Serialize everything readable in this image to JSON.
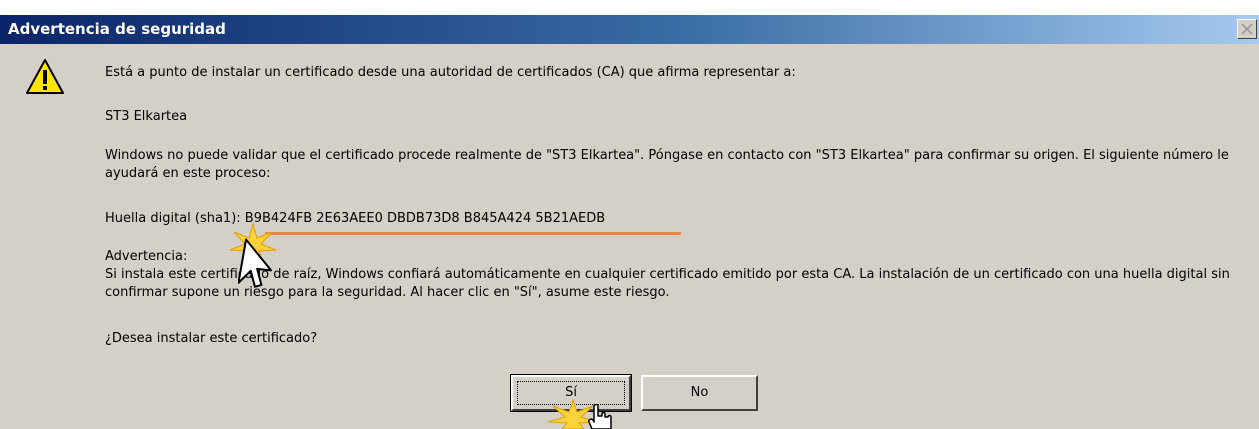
{
  "dialog": {
    "title": "Advertencia de seguridad",
    "intro": "Está a punto de instalar un certificado desde una autoridad de certificados (CA) que afirma representar a:",
    "ca_name": "ST3 Elkartea",
    "validation_text": "Windows no puede validar que el certificado procede realmente de \"ST3 Elkartea\". Póngase en contacto con \"ST3 Elkartea\" para confirmar su origen. El siguiente número le ayudará en este proceso:",
    "thumbprint_label": "Huella digital (sha1):",
    "thumbprint_value": "B9B424FB 2E63AEE0 DBDB73D8 B845A424 5B21AEDB",
    "warning_heading": "Advertencia:",
    "warning_text": "Si instala este certificado de raíz, Windows confiará automáticamente en cualquier certificado emitido por esta CA. La instalación de un certificado con una huella digital sin confirmar supone un riesgo para la seguridad. Al hacer clic en \"Sí\", asume este riesgo.",
    "question": "¿Desea instalar este certificado?"
  },
  "buttons": {
    "yes_label": "Sí",
    "no_label": "No"
  },
  "icons": {
    "warning": "warning-icon",
    "close": "close-icon",
    "cursor": "mouse-cursor-icon",
    "hand": "hand-pointer-icon"
  },
  "colors": {
    "titlebar_start": "#0a246a",
    "titlebar_end": "#a6caf0",
    "highlight_underline": "#f0844a",
    "dialog_bg": "#d4d0c8"
  }
}
